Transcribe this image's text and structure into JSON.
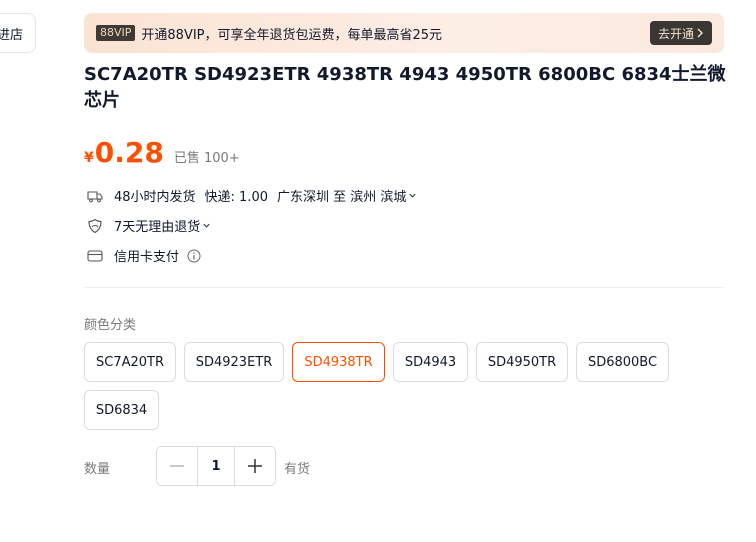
{
  "store": {
    "label": "进店"
  },
  "vip_banner": {
    "badge": "88VIP",
    "text": "开通88VIP，可享全年退货包运费，每单最高省25元",
    "cta": "去开通"
  },
  "product": {
    "title": "SC7A20TR SD4923ETR 4938TR 4943 4950TR 6800BC 6834士兰微 芯片",
    "currency": "¥",
    "price": "0.28",
    "sold": "已售 100+"
  },
  "service": {
    "shipping_time": "48小时内发货",
    "express": "快递: 1.00",
    "route": "广东深圳 至 滨州 滨城",
    "returns": "7天无理由退货",
    "payment": "信用卡支付"
  },
  "sku": {
    "label": "颜色分类",
    "options": [
      "SC7A20TR",
      "SD4923ETR",
      "SD4938TR",
      "SD4943",
      "SD4950TR",
      "SD6800BC",
      "SD6834"
    ],
    "selected": "SD4938TR"
  },
  "quantity": {
    "label": "数量",
    "value": "1",
    "stock": "有货"
  },
  "colors": {
    "accent": "#ff5000",
    "text": "#11192d",
    "muted": "#7a7a7a"
  }
}
